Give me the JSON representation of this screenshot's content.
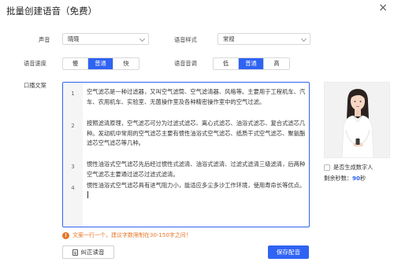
{
  "dialog": {
    "title": "批量创建语音（免费）",
    "close_glyph": "×"
  },
  "form": {
    "voice_label": "声音",
    "voice_value": "晓晓",
    "style_label": "语音样式",
    "style_value": "常规",
    "speed_label": "语音速度",
    "speed_options": [
      "慢",
      "普通",
      "快"
    ],
    "speed_selected": "普通",
    "pitch_label": "语音音调",
    "pitch_options": [
      "低",
      "普通",
      "高"
    ],
    "pitch_selected": "普通",
    "script_label": "口播文案"
  },
  "editor": {
    "lines": [
      {
        "no": "1",
        "text": "空气滤芯是一种过滤器，又叫空气滤筒、空气滤清器、风格等。主要用于工程机车、汽车、农用机车、实验室、无菌操作室及各种精密操作室中的空气过滤。"
      },
      {
        "no": "2",
        "text": "按照滤清原理，空气滤芯可分为过滤式滤芯、离心式滤芯、油浴式滤芯、复合式滤芯几种。发动机中常用的空气滤芯主要有惯性油浴式空气滤芯、纸质干式空气滤芯、聚氨酯滤芯空气滤芯等几种。"
      },
      {
        "no": "3",
        "text": "惯性油浴式空气滤芯先后经过惯性式滤清、油浴式滤清、过滤式滤清三级滤清，后两种空气滤芯主要通过滤芯过滤式滤清。"
      },
      {
        "no": "4",
        "text": "惯性油浴式空气滤芯具有进气阻力小，能适应多尘多沙工作环境，使用寿命长等优点。"
      }
    ]
  },
  "hint": {
    "icon": "!",
    "text": "文案一行一个，建议字数限制在30-150字之间！"
  },
  "buttons": {
    "correct_label": "纠正读音",
    "save_label": "保存配音"
  },
  "sidebar": {
    "digital_human_label": "是否生成数字人",
    "remaining_prefix": "剩余秒数：",
    "remaining_value": "90",
    "remaining_suffix": "秒"
  },
  "colors": {
    "accent": "#2f63f3",
    "warning": "#e6762a"
  }
}
